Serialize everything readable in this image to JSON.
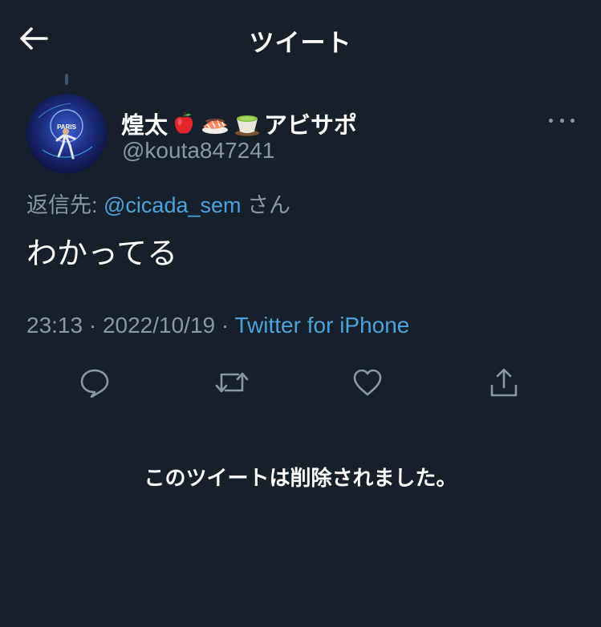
{
  "header": {
    "title": "ツイート",
    "back_icon": "arrow-left-icon"
  },
  "tweet": {
    "display_name_prefix": "煌太",
    "display_name_emojis": [
      "🍎",
      "🍣",
      "🍵"
    ],
    "display_name_suffix": "アビサポ",
    "handle": "@kouta847241",
    "reply_label": "返信先: ",
    "reply_target": "@cicada_sem",
    "reply_suffix": " さん",
    "text": "わかってる",
    "time": "23:13",
    "separator": " · ",
    "date": "2022/10/19",
    "source": "Twitter for iPhone"
  },
  "deleted_notice": "このツイートは削除されました。",
  "colors": {
    "background": "#15202b",
    "accent": "#4aa3df",
    "muted": "#8899a6",
    "text": "#ffffff"
  }
}
